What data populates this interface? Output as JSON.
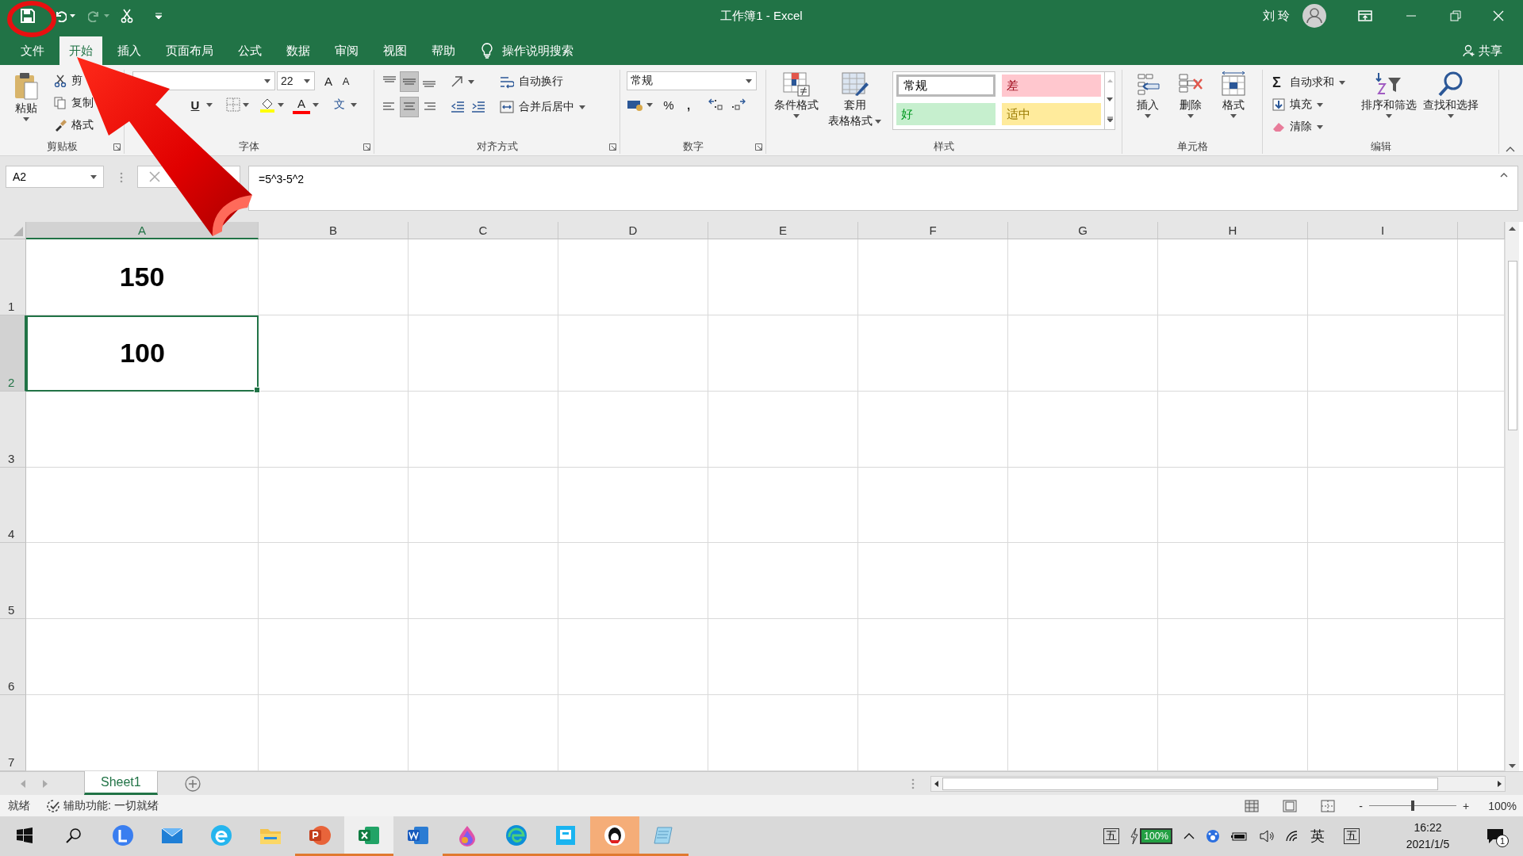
{
  "window": {
    "title": "工作簿1 - Excel",
    "user": "刘 玲"
  },
  "ribbon_tabs": [
    {
      "label": "文件",
      "selected": false
    },
    {
      "label": "开始",
      "selected": true
    },
    {
      "label": "插入",
      "selected": false
    },
    {
      "label": "页面布局",
      "selected": false
    },
    {
      "label": "公式",
      "selected": false
    },
    {
      "label": "数据",
      "selected": false
    },
    {
      "label": "审阅",
      "selected": false
    },
    {
      "label": "视图",
      "selected": false
    },
    {
      "label": "帮助",
      "selected": false
    }
  ],
  "tell_me": "操作说明搜索",
  "share": "共享",
  "clipboard": {
    "paste": "粘贴",
    "items": [
      "剪",
      "复制",
      "格式"
    ],
    "label": "剪贴板"
  },
  "font": {
    "size": "22",
    "grow": "A",
    "shrink": "A",
    "underline": "U",
    "font_color": "A",
    "phonetic": "文",
    "label": "字体"
  },
  "alignment": {
    "wrap": "自动换行",
    "merge": "合并后居中",
    "label": "对齐方式"
  },
  "number": {
    "format": "常规",
    "percent": "%",
    "comma": ",",
    "label": "数字"
  },
  "styles": {
    "conditional": "条件格式",
    "table": [
      "套用",
      "表格格式"
    ],
    "cell_styles": [
      {
        "label": "常规",
        "color": "#ffffff",
        "selected": true
      },
      {
        "label": "差",
        "color": "#ffc7ce",
        "selected": false
      },
      {
        "label": "好",
        "color": "#c6efce",
        "selected": false
      },
      {
        "label": "适中",
        "color": "#ffeb9c",
        "selected": false
      }
    ],
    "label": "样式"
  },
  "cells_group": {
    "buttons": [
      {
        "kind": "insert",
        "label": "插入"
      },
      {
        "kind": "delete",
        "label": "删除"
      },
      {
        "kind": "format",
        "label": "格式"
      }
    ],
    "label": "单元格"
  },
  "editing": {
    "sigma": "Σ",
    "autosum": "自动求和",
    "fill": "填充",
    "clear": "清除",
    "sort": "排序和筛选",
    "find": "查找和选择",
    "label": "编辑"
  },
  "formula_bar": {
    "name_box": "A2",
    "formula": "=5^3-5^2"
  },
  "columns": [
    {
      "label": "A",
      "selected": true
    },
    {
      "label": "B",
      "selected": false
    },
    {
      "label": "C",
      "selected": false
    },
    {
      "label": "D",
      "selected": false
    },
    {
      "label": "E",
      "selected": false
    },
    {
      "label": "F",
      "selected": false
    },
    {
      "label": "G",
      "selected": false
    },
    {
      "label": "H",
      "selected": false
    },
    {
      "label": "I",
      "selected": false
    }
  ],
  "rows": [
    {
      "header": "1",
      "selected": false,
      "cells": [
        "150"
      ]
    },
    {
      "header": "2",
      "selected": true,
      "cells": [
        "100"
      ]
    },
    {
      "header": "3",
      "selected": false
    },
    {
      "header": "4",
      "selected": false
    },
    {
      "header": "5",
      "selected": false
    },
    {
      "header": "6",
      "selected": false
    },
    {
      "header": "7",
      "selected": false
    }
  ],
  "sheets": [
    {
      "label": "Sheet1",
      "selected": true
    }
  ],
  "status_bar": {
    "ready": "就绪",
    "accessibility": "辅助功能: 一切就绪",
    "zoom_out": "-",
    "zoom_in": "+",
    "zoom_slider": {
      "level": 0.5
    },
    "zoom": "100%"
  },
  "taskbar": {
    "apps": [
      {
        "kind": "lark",
        "running": false,
        "selected": false,
        "flashing": false
      },
      {
        "kind": "mail",
        "running": false,
        "selected": false,
        "flashing": false
      },
      {
        "kind": "browser",
        "running": false,
        "selected": false,
        "flashing": false
      },
      {
        "kind": "folder",
        "running": false,
        "selected": false,
        "flashing": false
      },
      {
        "kind": "powerpoint",
        "running": true,
        "selected": false,
        "flashing": false
      },
      {
        "kind": "excel",
        "running": true,
        "selected": true,
        "flashing": false
      },
      {
        "kind": "word",
        "running": false,
        "selected": false,
        "flashing": false
      },
      {
        "kind": "paint",
        "running": true,
        "selected": false,
        "flashing": false
      },
      {
        "kind": "edge",
        "running": true,
        "selected": false,
        "flashing": false
      },
      {
        "kind": "tool",
        "running": true,
        "selected": false,
        "flashing": false
      },
      {
        "kind": "qq",
        "running": true,
        "selected": false,
        "flashing": true
      },
      {
        "kind": "notepad",
        "running": true,
        "selected": false,
        "flashing": false
      }
    ],
    "tray": {
      "ime_mode": "五",
      "battery": "100%",
      "language": "英",
      "ime": "五",
      "time": "16:22",
      "date": "2021/1/5",
      "notifications": "1"
    }
  }
}
